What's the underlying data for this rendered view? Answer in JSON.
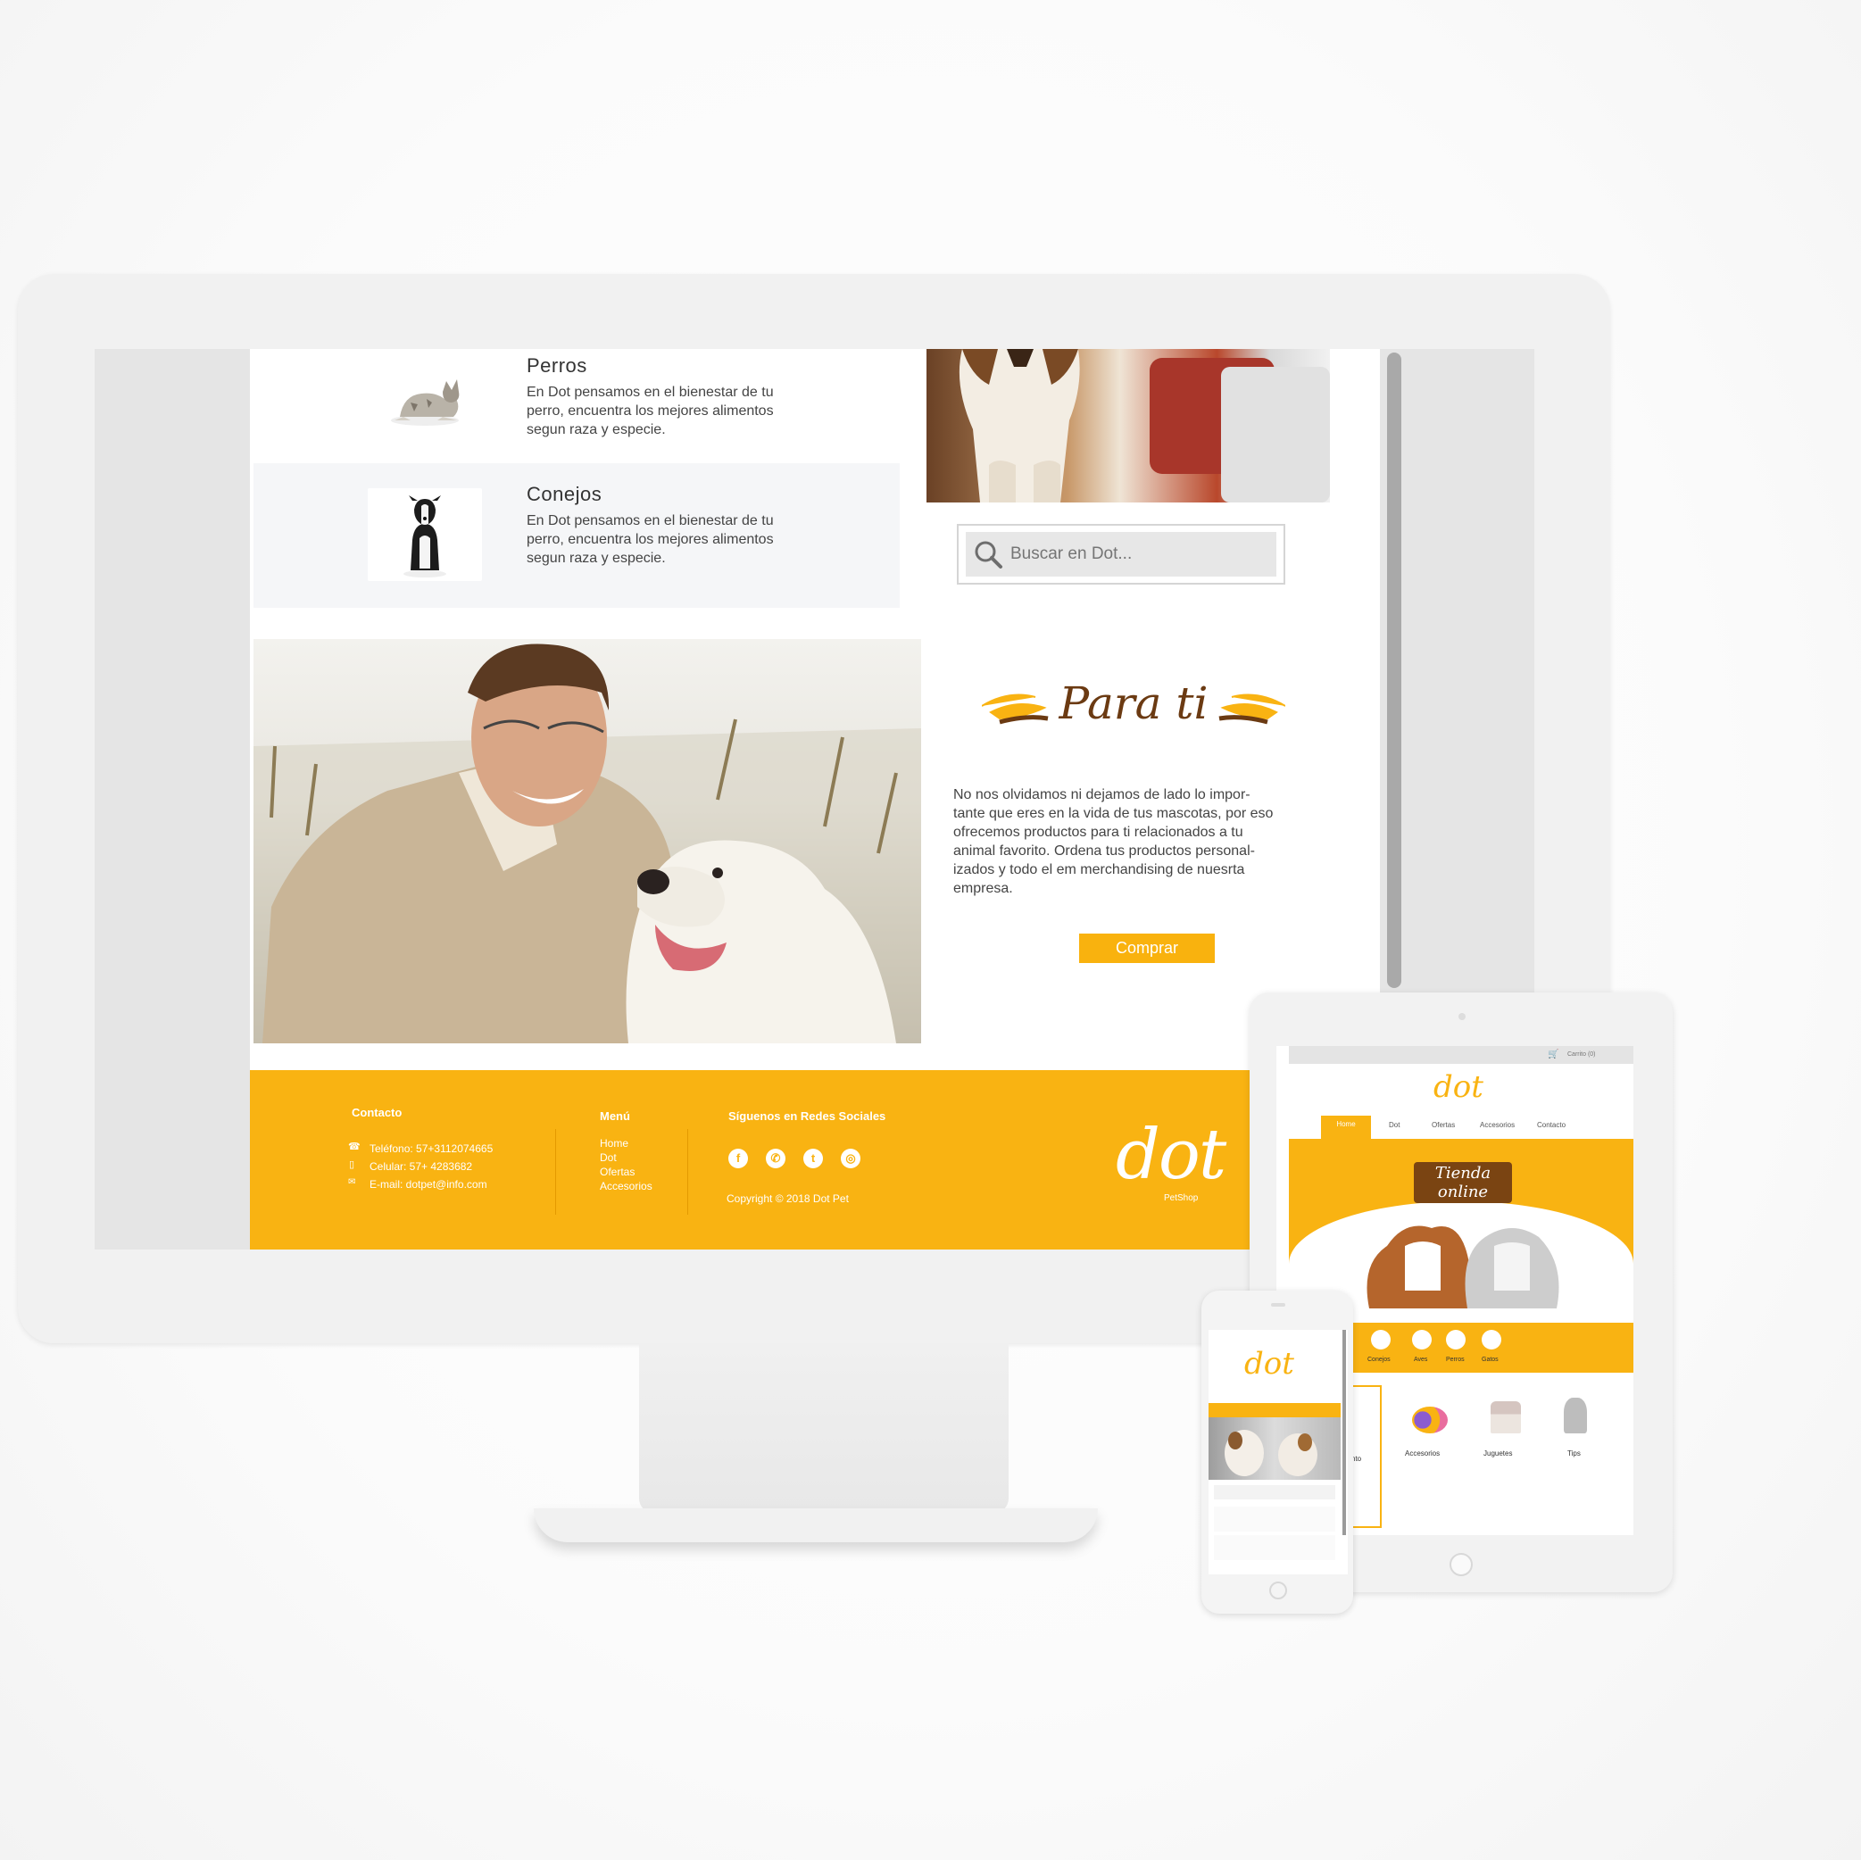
{
  "products": [
    {
      "title": "Perros",
      "description_lines": [
        "En Dot pensamos en el bienestar de tu",
        "perro, encuentra los mejores alimentos",
        "segun raza y especie."
      ]
    },
    {
      "title": "Conejos",
      "description_lines": [
        "En Dot pensamos en el bienestar de tu",
        "perro, encuentra los mejores alimentos",
        "segun raza y especie."
      ]
    }
  ],
  "search": {
    "placeholder": "Buscar en Dot..."
  },
  "promo": {
    "heading": "Para ti",
    "text_lines": [
      "No nos olvidamos ni dejamos de lado lo impor-",
      "tante que eres en la vida de tus mascotas, por eso",
      "ofrecemos productos para ti relacionados a tu",
      "animal favorito. Ordena tus productos personal-",
      "izados y todo el em merchandising de nuesrta",
      "empresa."
    ],
    "button": "Comprar"
  },
  "footer": {
    "contact_heading": "Contacto",
    "phone": "Teléfono: 57+3112074665",
    "mobile": "Celular: 57+ 4283682",
    "email": "E-mail: dotpet@info.com",
    "menu_heading": "Menú",
    "menu_items": [
      "Home",
      "Dot",
      "Ofertas",
      "Accesorios"
    ],
    "social_heading": "Síguenos en Redes Sociales",
    "copyright": "Copyright © 2018 Dot Pet",
    "logo": "dot",
    "logo_sub": "PetShop"
  },
  "tablet": {
    "cart": "Carrito (0)",
    "logo": "dot",
    "nav": [
      "Home",
      "Dot",
      "Ofertas",
      "Accesorios",
      "Contacto"
    ],
    "banner": "Tienda online",
    "categories": [
      "Conejos",
      "Aves",
      "Perros",
      "Gatos"
    ],
    "products": [
      "nto",
      "Accesorios",
      "Juguetes",
      "Tips"
    ]
  },
  "phone": {
    "logo": "dot"
  },
  "colors": {
    "brand": "#f9b312",
    "brown": "#6b3a12",
    "text": "#444444"
  }
}
